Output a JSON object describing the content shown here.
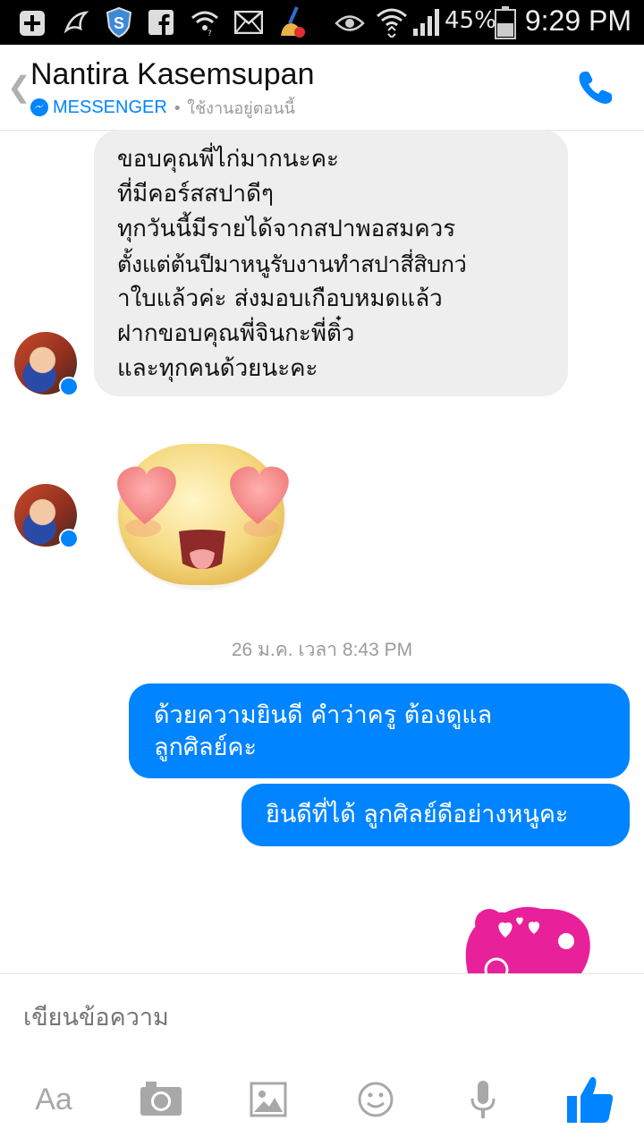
{
  "status_bar": {
    "battery_percent": "45%",
    "time": "9:29 PM",
    "icons": [
      "add-icon",
      "bird-icon",
      "shield-icon",
      "facebook-icon",
      "wifi-signal-icon",
      "mail-icon",
      "cleaner-icon",
      "eye-icon",
      "wifi-icon",
      "signal-icon",
      "battery-icon"
    ]
  },
  "header": {
    "contact_name": "Nantira Kasemsupan",
    "app_label": "MESSENGER",
    "status_text": "• ใช้งานอยู่ตอนนี้",
    "back_icon": "chevron-left-icon",
    "call_icon": "phone-icon"
  },
  "conversation": {
    "incoming_message": {
      "lines": [
        "ขอบคุณพี่ไก่มากนะคะ",
        "ที่มีคอร์สสปาดีๆ",
        "ทุกวันนี้มีรายได้จากสปาพอสมควร",
        "ตั้งแต่ต้นปีมาหนูรับงานทำสปาสี่สิบกว่",
        "าใบแล้วค่ะ ส่งมอบเกือบหมดแล้ว",
        "ฝากขอบคุณพี่จินกะพี่ติ๋ว",
        "และทุกคนด้วยนะคะ"
      ]
    },
    "emoji": "heart-eyes-emoji",
    "timestamp": "26 ม.ค. เวลา 8:43 PM",
    "outgoing_1": {
      "lines": [
        "ด้วยความยินดี คำว่าครู ต้องดูแล",
        "ลูกศิลย์คะ"
      ]
    },
    "outgoing_2": {
      "lines": [
        "ยินดีที่ได้ ลูกศิลย์ดีอย่างหนูคะ"
      ]
    },
    "sticker": "heart-bear-sticker"
  },
  "composer": {
    "placeholder": "เขียนข้อความ",
    "toolbar": {
      "text_label": "Aa",
      "icons": [
        "camera-icon",
        "image-icon",
        "emoji-icon",
        "microphone-icon",
        "thumbs-up-icon"
      ]
    }
  },
  "colors": {
    "accent": "#0084ff",
    "incoming_bubble": "#eeeeee",
    "sticker_pink": "#e8209a"
  }
}
